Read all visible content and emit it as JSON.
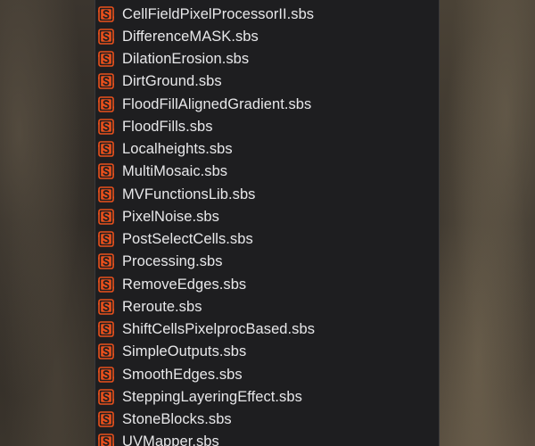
{
  "file_list": {
    "icon": "substance-designer-file-icon",
    "accent_color": "#e8501c",
    "items": [
      "CellFieldPixelProcessorII.sbs",
      "DifferenceMASK.sbs",
      "DilationErosion.sbs",
      "DirtGround.sbs",
      "FloodFillAlignedGradient.sbs",
      "FloodFills.sbs",
      "Localheights.sbs",
      "MultiMosaic.sbs",
      "MVFunctionsLib.sbs",
      "PixelNoise.sbs",
      "PostSelectCells.sbs",
      "Processing.sbs",
      "RemoveEdges.sbs",
      "Reroute.sbs",
      "ShiftCellsPixelprocBased.sbs",
      "SimpleOutputs.sbs",
      "SmoothEdges.sbs",
      "SteppingLayeringEffect.sbs",
      "StoneBlocks.sbs",
      "UVMapper.sbs"
    ]
  }
}
